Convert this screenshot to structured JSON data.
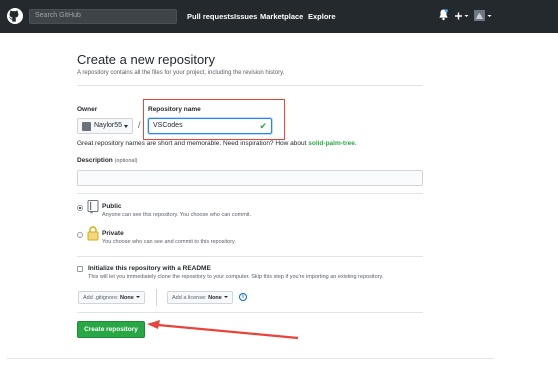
{
  "header": {
    "search_placeholder": "Search GitHub",
    "nav": [
      "Pull requests",
      "Issues",
      "Marketplace",
      "Explore"
    ],
    "icons": [
      "github-logo",
      "bell-icon",
      "plus-icon",
      "avatar"
    ]
  },
  "page": {
    "title": "Create a new repository",
    "subtitle": "A repository contains all the files for your project, including the revision history."
  },
  "form": {
    "owner_label": "Owner",
    "owner_value": "Naylor55",
    "slash": "/",
    "repo_label": "Repository name",
    "repo_value": "VSCodes",
    "great_text": "Great repository names are short and memorable. Need inspiration? How about ",
    "suggestion": "solid-palm-tree",
    "suggestion_end": ".",
    "description_label": "Description",
    "description_optional": "(optional)",
    "public_title": "Public",
    "public_desc": "Anyone can see this repository. You choose who can commit.",
    "private_title": "Private",
    "private_desc": "You choose who can see and commit to this repository.",
    "readme_title": "Initialize this repository with a README",
    "readme_desc": "This will let you immediately clone the repository to your computer. Skip this step if you're importing an existing repository.",
    "gitignore_label": "Add .gitignore:",
    "gitignore_value": "None",
    "license_label": "Add a license:",
    "license_value": "None",
    "info_glyph": "i",
    "create_button": "Create repository",
    "visibility_selected": "public"
  },
  "colors": {
    "header_bg": "#24292e",
    "accent_green": "#28a745",
    "highlight_red": "#e8443a",
    "focus_blue": "#2188ff"
  }
}
